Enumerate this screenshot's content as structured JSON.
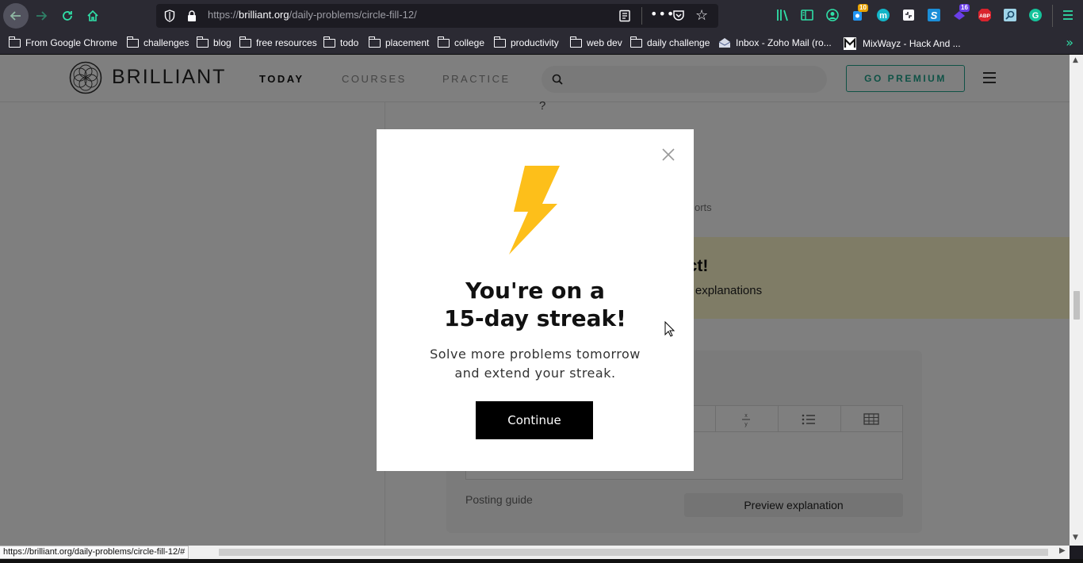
{
  "browser": {
    "url_prefix": "https://",
    "url_domain": "brilliant.org",
    "url_path": "/daily-problems/circle-fill-12/",
    "extensions": [
      {
        "name": "library-icon"
      },
      {
        "name": "sidebar-icon"
      },
      {
        "name": "account-icon"
      },
      {
        "name": "extension-badge-icon",
        "badge": "10"
      },
      {
        "name": "m-extension-icon"
      },
      {
        "name": "screenshot-icon"
      },
      {
        "name": "s-extension-icon"
      },
      {
        "name": "purple-extension-icon",
        "badge": "16"
      },
      {
        "name": "adblock-icon",
        "label": "ABP"
      },
      {
        "name": "search-extension-icon"
      },
      {
        "name": "grammarly-icon",
        "label": "G"
      },
      {
        "name": "menu-icon"
      }
    ]
  },
  "bookmarks": [
    {
      "label": "From Google Chrome",
      "type": "folder"
    },
    {
      "label": "challenges",
      "type": "folder"
    },
    {
      "label": "blog",
      "type": "folder"
    },
    {
      "label": "free resources",
      "type": "folder"
    },
    {
      "label": "todo",
      "type": "folder"
    },
    {
      "label": "placement",
      "type": "folder"
    },
    {
      "label": "college",
      "type": "folder"
    },
    {
      "label": "productivity",
      "type": "folder"
    },
    {
      "label": "web dev",
      "type": "folder"
    },
    {
      "label": "daily challenge",
      "type": "folder"
    },
    {
      "label": "Inbox - Zoho Mail (ro...",
      "type": "link"
    },
    {
      "label": "MixWayz - Hack And ...",
      "type": "link"
    }
  ],
  "site": {
    "logo": "BRILLIANT",
    "nav": [
      "TODAY",
      "COURSES",
      "PRACTICE"
    ],
    "premium": "GO PREMIUM"
  },
  "background": {
    "frag_question": "?",
    "frag_reports": "orts",
    "frag_correct": "ect!",
    "frag_explanations": "ng explanations",
    "posting_guide": "Posting guide",
    "preview": "Preview explanation"
  },
  "modal": {
    "title_line1": "You're on a",
    "title_line2": "15-day streak!",
    "body_line1": "Solve more problems tomorrow",
    "body_line2": "and extend your streak.",
    "continue": "Continue",
    "bolt_color": "#fdbf1a"
  },
  "status": {
    "url": "https://brilliant.org/daily-problems/circle-fill-12/#"
  }
}
